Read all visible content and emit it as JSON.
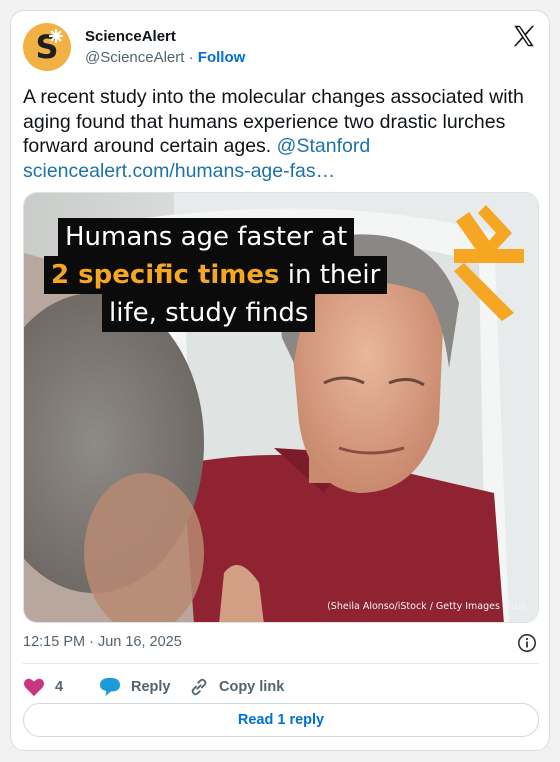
{
  "author": {
    "name": "ScienceAlert",
    "handle": "@ScienceAlert",
    "separator": "·",
    "follow_label": "Follow",
    "avatar_letter": "S"
  },
  "tweet": {
    "text": "A recent study into the molecular changes associated with aging found that humans experience two drastic lurches forward around certain ages.",
    "mention": "@Stanford",
    "link": "sciencealert.com/humans-age-fas…"
  },
  "media": {
    "headline_line1": "Humans age faster at",
    "headline_line2_highlight": "2 specific times",
    "headline_line2_rest": " in their",
    "headline_line3": "life, study finds",
    "credit": "(Sheila Alonso/iStock / Getty Images Plus)"
  },
  "meta": {
    "timestamp": "12:15 PM · Jun 16, 2025"
  },
  "actions": {
    "like_count": "4",
    "reply_label": "Reply",
    "copy_label": "Copy link"
  },
  "footer": {
    "read_replies_label": "Read 1 reply"
  },
  "colors": {
    "accent_blue": "#006fd6",
    "link_blue": "#1d73a8",
    "like_pink": "#c9367f",
    "headline_orange": "#f5a623",
    "avatar_gold": "#f1b144"
  },
  "icons": {
    "platform_logo": "x-logo-icon",
    "info": "info-icon",
    "like": "heart-icon",
    "reply": "speech-bubble-icon",
    "copy": "link-icon"
  }
}
